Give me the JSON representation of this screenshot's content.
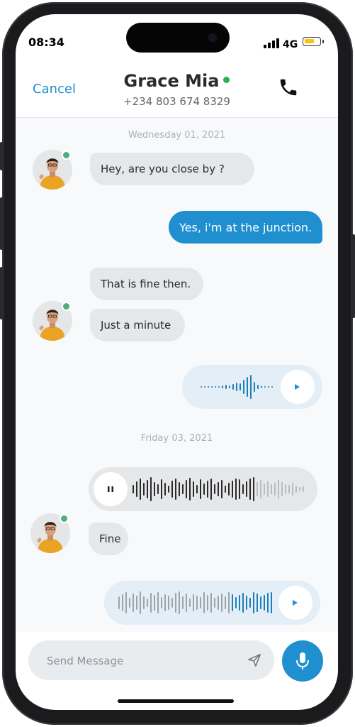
{
  "status_bar": {
    "time": "08:34",
    "network": "4G"
  },
  "header": {
    "cancel_label": "Cancel",
    "contact_name": "Grace Mia",
    "contact_phone": "+234 803 674 8329",
    "call_icon": "phone-icon"
  },
  "chat": {
    "date_1": "Wednesday 01, 2021",
    "date_2": "Friday 03, 2021",
    "messages": {
      "m1": "Hey, are you close by ?",
      "m2": "Yes, i'm at the junction.",
      "m3": "That is fine then.",
      "m4": "Just a minute",
      "m5": "Fine"
    }
  },
  "composer": {
    "placeholder": "Send Message",
    "send_icon": "send-icon",
    "mic_icon": "microphone-icon"
  },
  "colors": {
    "accent": "#1f8fd0",
    "online": "#27b24a",
    "incoming_bubble": "#e6e7e9",
    "voice_out_bg": "#e3eef7"
  }
}
